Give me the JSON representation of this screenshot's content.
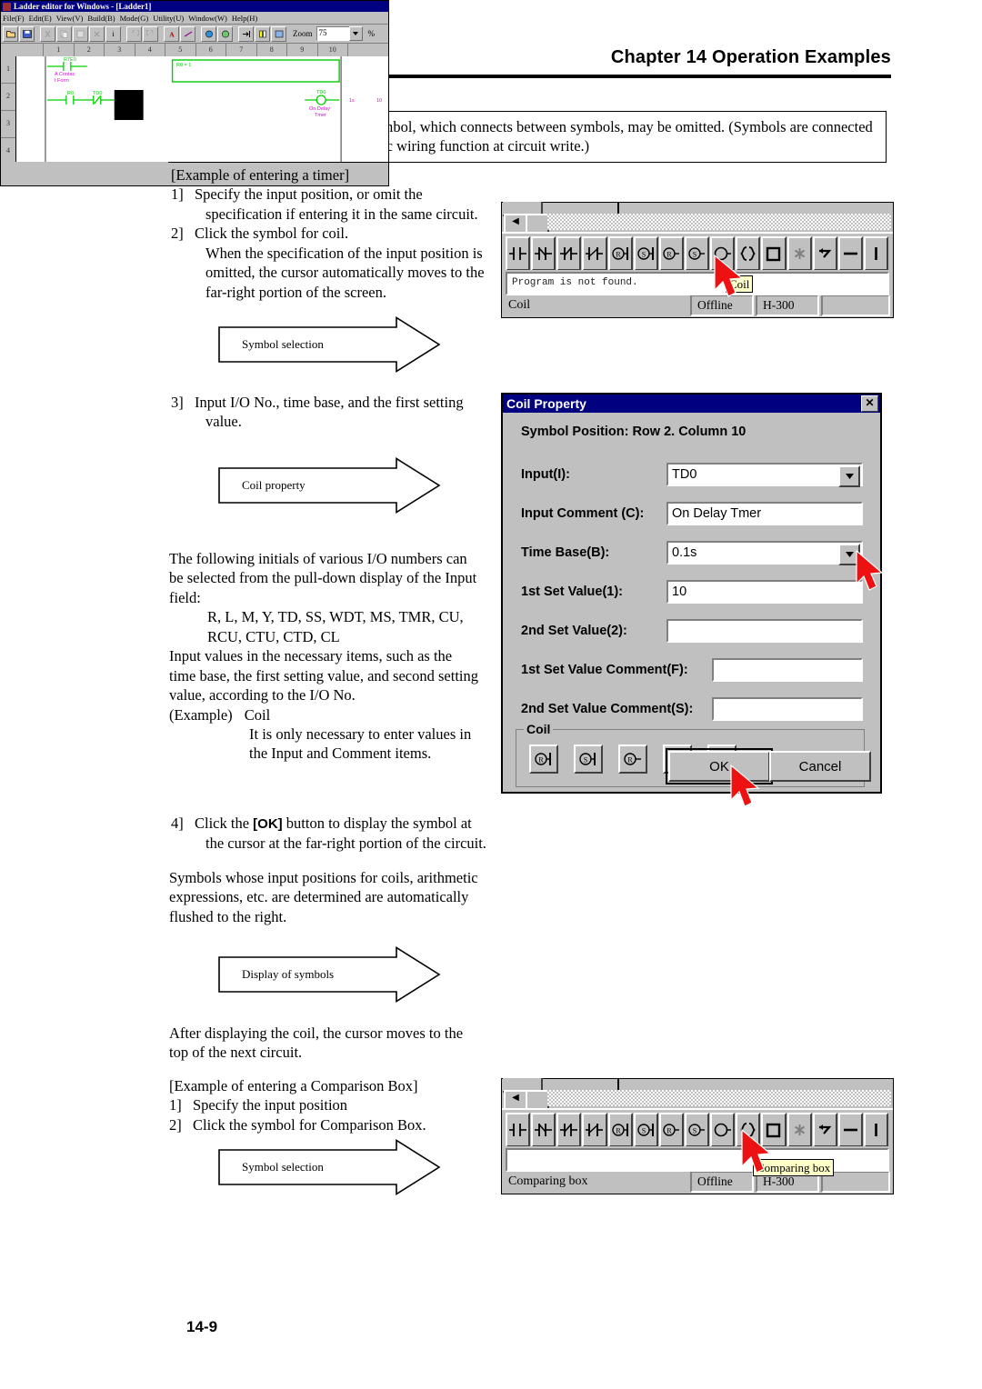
{
  "header": {
    "chapter_title": "Chapter 14  Operation Examples"
  },
  "note_box": {
    "text": "The input of the horizontal line symbol, which connects between symbols, may be omitted. (Symbols are connected by horizontal lines by the automatic wiring function at circuit write.)"
  },
  "body": {
    "timer_heading": "[Example of entering a timer]",
    "step1_num": "1]",
    "step1_l1": "Specify the input position, or omit the",
    "step1_l2": "specification if entering it in the same circuit.",
    "step2_num": "2]",
    "step2_l1": "Click the symbol for coil.",
    "step2_l2": "When the specification of the input position is",
    "step2_l3": "omitted, the cursor automatically moves to the",
    "step2_l4": "far-right portion of the screen.",
    "step3_num": "3]",
    "step3_l1": "Input I/O No., time base, and the first setting",
    "step3_l2": "value.",
    "para_initials_l1": "The following initials of various I/O numbers can",
    "para_initials_l2": "be selected from the pull-down display of the Input",
    "para_initials_l3": "field:",
    "initials_l1": "R, L, M, Y, TD, SS, WDT, MS, TMR, CU,",
    "initials_l2": "RCU, CTU, CTD, CL",
    "para_input_l1": "Input values in the necessary items, such as the",
    "para_input_l2": "time base, the first setting value, and second setting",
    "para_input_l3": "value, according to the I/O No.",
    "example_label": "(Example)",
    "example_value": "Coil",
    "example_l1": "It is only necessary to enter values in",
    "example_l2": "the Input and Comment items.",
    "step4_num": "4]",
    "step4_a": "Click the ",
    "step4_ok": "[OK]",
    "step4_b": " button to display the symbol at",
    "step4_l2": "the cursor at the far-right portion of the circuit.",
    "para_flush_l1": "Symbols whose input positions for coils, arithmetic",
    "para_flush_l2": "expressions, etc. are determined are automatically",
    "para_flush_l3": "flushed to the right.",
    "para_after_l1": "After displaying the coil, the cursor moves to the",
    "para_after_l2": "top of the next circuit.",
    "compare_heading": "[Example of entering a Comparison Box]",
    "cstep1_num": "1]",
    "cstep1_text": "Specify the input position",
    "cstep2_num": "2]",
    "cstep2_text": "Click the symbol for Comparison Box."
  },
  "banners": {
    "symbol_selection_1": "Symbol selection",
    "coil_property": "Coil property",
    "display_of_symbols": "Display of symbols",
    "symbol_selection_2": "Symbol selection"
  },
  "toolbar_coil": {
    "message": "Program is not found.",
    "tooltip": "Coil",
    "status_main": "Coil",
    "status_mode": "Offline",
    "status_model": "H-300",
    "symbols": [
      "contact-a-icon",
      "contact-b-icon",
      "contact-transition-icon",
      "contact-not-icon",
      "coil-reset-latch-icon",
      "coil-set-latch-icon",
      "coil-reset-icon",
      "coil-set-icon",
      "coil-icon",
      "comparing-box-icon",
      "box-icon",
      "asterisk-icon",
      "jump-icon",
      "horizontal-line-icon",
      "vertical-line-icon"
    ],
    "highlighted_symbol_index": 8
  },
  "toolbar_compare": {
    "message": "",
    "tooltip": "Comparing box",
    "status_main": "Comparing box",
    "status_mode": "Offline",
    "status_model": "H-300",
    "highlighted_symbol_index": 9
  },
  "coil_property": {
    "title": "Coil Property",
    "close_label": "✕",
    "symbol_position": "Symbol Position:  Row 2. Column 10",
    "fields": [
      {
        "label": "Input(I):",
        "value": "TD0",
        "type": "combo"
      },
      {
        "label": "Input Comment (C):",
        "value": "On Delay Tmer",
        "type": "text"
      },
      {
        "label": "Time Base(B):",
        "value": "0.1s",
        "type": "combo"
      },
      {
        "label": "1st Set Value(1):",
        "value": "10",
        "type": "text"
      },
      {
        "label": "2nd Set Value(2):",
        "value": "",
        "type": "text"
      },
      {
        "label": "1st Set Value Comment(F):",
        "value": "",
        "type": "text"
      },
      {
        "label": "2nd Set Value Comment(S):",
        "value": "",
        "type": "text"
      }
    ],
    "coil_group_label": "Coil",
    "coil_buttons": [
      "coil-reset-latch-icon",
      "coil-set-latch-icon",
      "coil-reset-icon",
      "coil-set-icon",
      "coil-icon"
    ],
    "ok_label": "OK",
    "cancel_label": "Cancel"
  },
  "ladder_editor": {
    "title": "Ladder editor for Windows - [Ladder1]",
    "menus": [
      "File(F)",
      "Edit(E)",
      "View(V)",
      "Build(B)",
      "Mode(G)",
      "Utility(U)",
      "Window(W)",
      "Help(H)"
    ],
    "zoom_label": "Zoom",
    "zoom_value": "75",
    "percent_label": "%",
    "column_headers": [
      "1",
      "2",
      "3",
      "4",
      "5",
      "6",
      "7",
      "8",
      "9",
      "10"
    ],
    "row_headers": [
      "1",
      "2",
      "3",
      "4"
    ],
    "circuit": {
      "row1_contact_label": "R7E0",
      "row1_comment_l1": "A Contac",
      "row1_comment_l2": "t Form",
      "row2_contact1_label": "R0",
      "row2_contact2_label": "TD0",
      "row2_coil_label": "TD0",
      "row2_coil_comment_l1": "On Delay",
      "row2_coil_comment_l2": "Tmer",
      "box_label": "R0 = 1",
      "right_val1": "1s",
      "right_val2": "10"
    }
  },
  "footer": {
    "page_number": "14-9"
  },
  "colors": {
    "titlebar": "#000080",
    "dialog_face": "#c0c0c0",
    "tooltip_bg": "#ffffc8",
    "cursor_red": "#ee1111",
    "ladder_green": "#00d000",
    "ladder_magenta": "#e000e0"
  }
}
